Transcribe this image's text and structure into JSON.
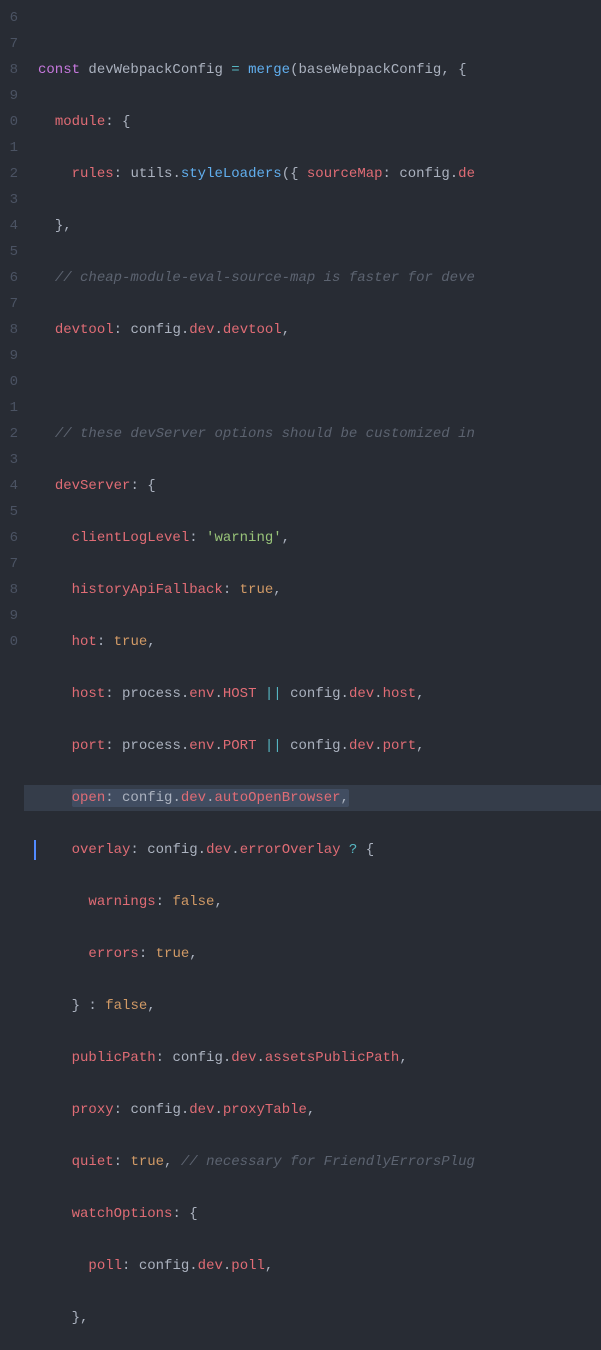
{
  "gutter_digits": [
    "6",
    "7",
    "8",
    "9",
    "0",
    "1",
    "2",
    "3",
    "4",
    "5",
    "6",
    "7",
    "8",
    "9",
    "0",
    "1",
    "2",
    "3",
    "4",
    "5",
    "6",
    "7",
    "8",
    "9",
    "0"
  ],
  "tokens": {
    "const": "const",
    "varName": "devWebpackConfig",
    "eq": "=",
    "merge": "merge",
    "baseCfg": "baseWebpackConfig",
    "lparen": "(",
    "rparen": ")",
    "lbrace": "{",
    "rbrace": "}",
    "comma": ",",
    "colon": ":",
    "dot": ".",
    "qmark": "?",
    "pipe2": "||",
    "module": "module",
    "rules": "rules",
    "utils": "utils",
    "styleLoaders": "styleLoaders",
    "sourceMap": "sourceMap",
    "config": "config",
    "dev": "dev",
    "de_cut": "de",
    "cmt1": "// cheap-module-eval-source-map is faster for deve",
    "devtool": "devtool",
    "cmt2": "// these devServer options should be customized in",
    "devServer": "devServer",
    "clientLogLevel": "clientLogLevel",
    "warning": "'warning'",
    "historyApiFallback": "historyApiFallback",
    "true": "true",
    "false": "false",
    "hot": "hot",
    "host": "host",
    "port": "port",
    "process": "process",
    "env": "env",
    "HOST": "HOST",
    "PORT": "PORT",
    "open": "open",
    "autoOpenBrowser": "autoOpenBrowser",
    "overlay": "overlay",
    "errorOverlay": "errorOverlay",
    "warnings": "warnings",
    "errors": "errors",
    "publicPath": "publicPath",
    "assetsPublicPath": "assetsPublicPath",
    "proxy": "proxy",
    "proxyTable": "proxyTable",
    "quiet": "quiet",
    "cmt3": "// necessary for FriendlyErrorsPlug",
    "watchOptions": "watchOptions",
    "poll": "poll"
  },
  "highlighted_line_index": 14
}
